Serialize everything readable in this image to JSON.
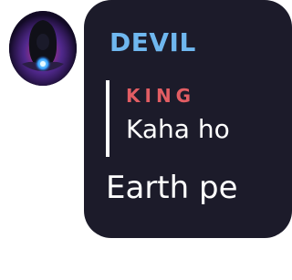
{
  "avatar": {
    "icon": "user-avatar-icon"
  },
  "message": {
    "sender": "DEVIL",
    "sender_color": "#6fb7ef",
    "reply": {
      "author": "KING",
      "author_color": "#e25d63",
      "text": "Kaha ho"
    },
    "text": "Earth pe"
  }
}
